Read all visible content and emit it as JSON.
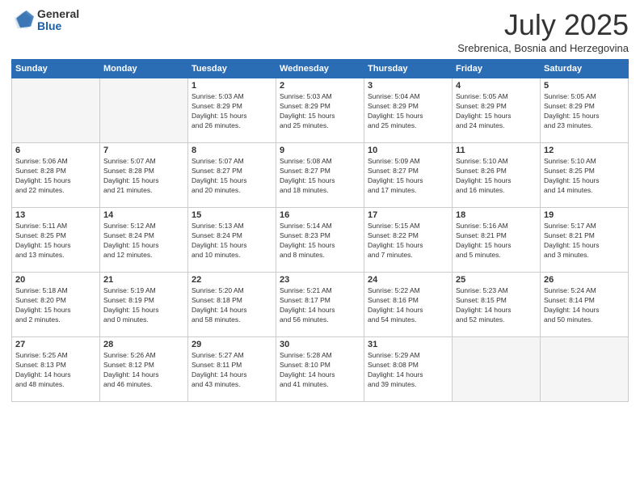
{
  "logo": {
    "general": "General",
    "blue": "Blue"
  },
  "header": {
    "month": "July 2025",
    "location": "Srebrenica, Bosnia and Herzegovina"
  },
  "weekdays": [
    "Sunday",
    "Monday",
    "Tuesday",
    "Wednesday",
    "Thursday",
    "Friday",
    "Saturday"
  ],
  "weeks": [
    [
      {
        "day": "",
        "info": ""
      },
      {
        "day": "",
        "info": ""
      },
      {
        "day": "1",
        "info": "Sunrise: 5:03 AM\nSunset: 8:29 PM\nDaylight: 15 hours\nand 26 minutes."
      },
      {
        "day": "2",
        "info": "Sunrise: 5:03 AM\nSunset: 8:29 PM\nDaylight: 15 hours\nand 25 minutes."
      },
      {
        "day": "3",
        "info": "Sunrise: 5:04 AM\nSunset: 8:29 PM\nDaylight: 15 hours\nand 25 minutes."
      },
      {
        "day": "4",
        "info": "Sunrise: 5:05 AM\nSunset: 8:29 PM\nDaylight: 15 hours\nand 24 minutes."
      },
      {
        "day": "5",
        "info": "Sunrise: 5:05 AM\nSunset: 8:29 PM\nDaylight: 15 hours\nand 23 minutes."
      }
    ],
    [
      {
        "day": "6",
        "info": "Sunrise: 5:06 AM\nSunset: 8:28 PM\nDaylight: 15 hours\nand 22 minutes."
      },
      {
        "day": "7",
        "info": "Sunrise: 5:07 AM\nSunset: 8:28 PM\nDaylight: 15 hours\nand 21 minutes."
      },
      {
        "day": "8",
        "info": "Sunrise: 5:07 AM\nSunset: 8:27 PM\nDaylight: 15 hours\nand 20 minutes."
      },
      {
        "day": "9",
        "info": "Sunrise: 5:08 AM\nSunset: 8:27 PM\nDaylight: 15 hours\nand 18 minutes."
      },
      {
        "day": "10",
        "info": "Sunrise: 5:09 AM\nSunset: 8:27 PM\nDaylight: 15 hours\nand 17 minutes."
      },
      {
        "day": "11",
        "info": "Sunrise: 5:10 AM\nSunset: 8:26 PM\nDaylight: 15 hours\nand 16 minutes."
      },
      {
        "day": "12",
        "info": "Sunrise: 5:10 AM\nSunset: 8:25 PM\nDaylight: 15 hours\nand 14 minutes."
      }
    ],
    [
      {
        "day": "13",
        "info": "Sunrise: 5:11 AM\nSunset: 8:25 PM\nDaylight: 15 hours\nand 13 minutes."
      },
      {
        "day": "14",
        "info": "Sunrise: 5:12 AM\nSunset: 8:24 PM\nDaylight: 15 hours\nand 12 minutes."
      },
      {
        "day": "15",
        "info": "Sunrise: 5:13 AM\nSunset: 8:24 PM\nDaylight: 15 hours\nand 10 minutes."
      },
      {
        "day": "16",
        "info": "Sunrise: 5:14 AM\nSunset: 8:23 PM\nDaylight: 15 hours\nand 8 minutes."
      },
      {
        "day": "17",
        "info": "Sunrise: 5:15 AM\nSunset: 8:22 PM\nDaylight: 15 hours\nand 7 minutes."
      },
      {
        "day": "18",
        "info": "Sunrise: 5:16 AM\nSunset: 8:21 PM\nDaylight: 15 hours\nand 5 minutes."
      },
      {
        "day": "19",
        "info": "Sunrise: 5:17 AM\nSunset: 8:21 PM\nDaylight: 15 hours\nand 3 minutes."
      }
    ],
    [
      {
        "day": "20",
        "info": "Sunrise: 5:18 AM\nSunset: 8:20 PM\nDaylight: 15 hours\nand 2 minutes."
      },
      {
        "day": "21",
        "info": "Sunrise: 5:19 AM\nSunset: 8:19 PM\nDaylight: 15 hours\nand 0 minutes."
      },
      {
        "day": "22",
        "info": "Sunrise: 5:20 AM\nSunset: 8:18 PM\nDaylight: 14 hours\nand 58 minutes."
      },
      {
        "day": "23",
        "info": "Sunrise: 5:21 AM\nSunset: 8:17 PM\nDaylight: 14 hours\nand 56 minutes."
      },
      {
        "day": "24",
        "info": "Sunrise: 5:22 AM\nSunset: 8:16 PM\nDaylight: 14 hours\nand 54 minutes."
      },
      {
        "day": "25",
        "info": "Sunrise: 5:23 AM\nSunset: 8:15 PM\nDaylight: 14 hours\nand 52 minutes."
      },
      {
        "day": "26",
        "info": "Sunrise: 5:24 AM\nSunset: 8:14 PM\nDaylight: 14 hours\nand 50 minutes."
      }
    ],
    [
      {
        "day": "27",
        "info": "Sunrise: 5:25 AM\nSunset: 8:13 PM\nDaylight: 14 hours\nand 48 minutes."
      },
      {
        "day": "28",
        "info": "Sunrise: 5:26 AM\nSunset: 8:12 PM\nDaylight: 14 hours\nand 46 minutes."
      },
      {
        "day": "29",
        "info": "Sunrise: 5:27 AM\nSunset: 8:11 PM\nDaylight: 14 hours\nand 43 minutes."
      },
      {
        "day": "30",
        "info": "Sunrise: 5:28 AM\nSunset: 8:10 PM\nDaylight: 14 hours\nand 41 minutes."
      },
      {
        "day": "31",
        "info": "Sunrise: 5:29 AM\nSunset: 8:08 PM\nDaylight: 14 hours\nand 39 minutes."
      },
      {
        "day": "",
        "info": ""
      },
      {
        "day": "",
        "info": ""
      }
    ]
  ]
}
